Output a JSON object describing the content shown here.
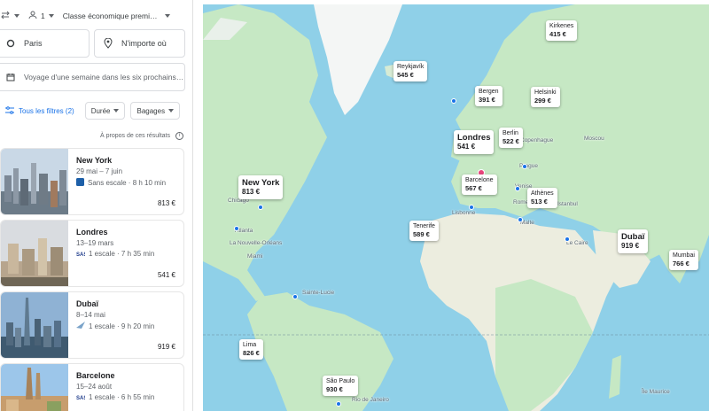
{
  "search": {
    "passengers": "1",
    "cabin": "Classe économique premi…",
    "origin": "Paris",
    "destination_placeholder": "N'importe où",
    "dates_placeholder": "Voyage d'une semaine dans les six prochains…"
  },
  "filters": {
    "all": "Tous les filtres (2)",
    "duration": "Durée",
    "bags": "Bagages"
  },
  "results_note": "À propos de ces résultats",
  "cards": [
    {
      "city": "New York",
      "dates": "29 mai – 7 juin",
      "stops": "Sans escale · 8 h 10 min",
      "price": "813 €"
    },
    {
      "city": "Londres",
      "dates": "13–19 mars",
      "stops": "1 escale · 7 h 35 min",
      "price": "541 €"
    },
    {
      "city": "Dubaï",
      "dates": "8–14 mai",
      "stops": "1 escale · 9 h 20 min",
      "price": "919 €"
    },
    {
      "city": "Barcelone",
      "dates": "15–24 août",
      "stops": "1 escale · 6 h 55 min",
      "price": ""
    }
  ],
  "map_destinations": [
    {
      "city": "Kirkenes",
      "price": "415 €"
    },
    {
      "city": "Reykjavík",
      "price": "545 €"
    },
    {
      "city": "Bergen",
      "price": "391 €"
    },
    {
      "city": "Helsinki",
      "price": "299 €"
    },
    {
      "city": "Londres",
      "price": "541 €"
    },
    {
      "city": "Berlin",
      "price": "522 €"
    },
    {
      "city": "New York",
      "price": "813 €"
    },
    {
      "city": "Barcelone",
      "price": "567 €"
    },
    {
      "city": "Athènes",
      "price": "513 €"
    },
    {
      "city": "Tenerife",
      "price": "589 €"
    },
    {
      "city": "Dubaï",
      "price": "919 €"
    },
    {
      "city": "Mumbai",
      "price": "766 €"
    },
    {
      "city": "Lima",
      "price": "826 €"
    },
    {
      "city": "São Paulo",
      "price": "930 €"
    }
  ],
  "map_places": {
    "copenhague": "Copenhague",
    "moscou": "Moscou",
    "prague": "Prague",
    "venise": "Venise",
    "lisbonne": "Lisbonne",
    "rome": "Rome",
    "malte": "Malte",
    "istanbul": "Istanbul",
    "le_caire": "Le Caire",
    "chicago": "Chicago",
    "atlanta": "Atlanta",
    "nouvelle_orleans": "La Nouvelle-Orléans",
    "miami": "Miami",
    "sainte_lucie": "Sainte-Lucie",
    "ile_maurice": "Île Maurice",
    "rio": "Rio de Janeiro"
  },
  "colors": {
    "accent": "#1a73e8",
    "water": "#8fd0e8",
    "land": "#c6e8c4",
    "desert": "#eceddf",
    "ice": "#f4f6f5",
    "origin_marker": "#e8457c"
  }
}
